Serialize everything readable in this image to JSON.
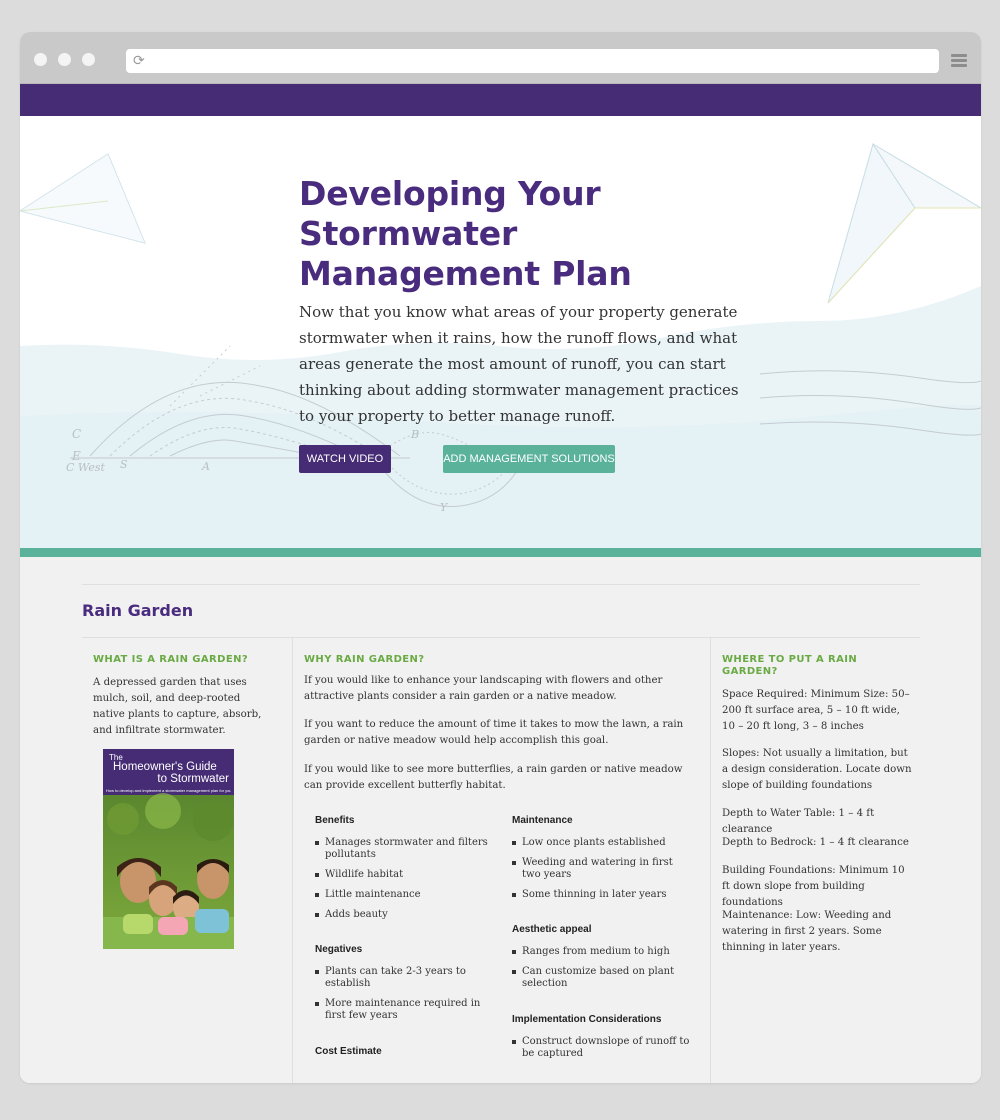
{
  "browser": {
    "reload_glyph": "⟳"
  },
  "hero": {
    "title": "Developing Your Stormwater Management Plan",
    "intro": "Now that you know what areas of your property generate stormwater when it rains, how the runoff flows, and what areas generate the most amount of runoff, you can start thinking about adding stormwater management practices to your property to better manage runoff.",
    "watch_video_label": "WATCH VIDEO",
    "add_solutions_label": "ADD MANAGEMENT SOLUTIONS",
    "sketch_labels": [
      "E",
      "C",
      "C West",
      "S",
      "A",
      "B",
      "Y"
    ]
  },
  "section": {
    "title": "Rain Garden"
  },
  "col1": {
    "heading": "WHAT IS A RAIN GARDEN?",
    "text": "A depressed garden that uses mulch, soil, and deep-rooted native plants to capture, absorb, and infiltrate stormwater.",
    "booklet": {
      "title_line1": "The",
      "title_line2": "Homeowner's Guide",
      "title_line3": "to Stormwater",
      "subtitle": "How to develop and implement a stormwater management plan for your property"
    }
  },
  "col2": {
    "heading": "WHY RAIN GARDEN?",
    "paragraphs": [
      "If you would like to enhance your landscaping with flowers and other attractive plants consider a rain garden or a native meadow.",
      "If you want to reduce the amount of time it takes to mow the lawn, a rain garden or native meadow would help accomplish this goal.",
      "If you would like to see more butterflies, a rain garden or native meadow can provide excellent butterfly habitat."
    ],
    "benefits": {
      "title": "Benefits",
      "items": [
        "Manages stormwater and filters pollutants",
        "Wildlife habitat",
        "Little maintenance",
        "Adds beauty"
      ]
    },
    "negatives": {
      "title": "Negatives",
      "items": [
        "Plants can take 2-3 years to establish",
        "More maintenance required in first few years"
      ]
    },
    "cost": {
      "title": "Cost Estimate"
    },
    "maintenance": {
      "title": "Maintenance",
      "items": [
        "Low once plants established",
        "Weeding and watering in first two years",
        "Some thinning in later years"
      ]
    },
    "aesthetic": {
      "title": "Aesthetic appeal",
      "items": [
        "Ranges from medium to high",
        "Can customize based on plant selection"
      ]
    },
    "implementation": {
      "title": "Implementation Considerations",
      "items": [
        "Construct downslope of runoff to be captured"
      ]
    }
  },
  "col3": {
    "heading": "WHERE TO PUT A RAIN GARDEN?",
    "items": [
      "Space Required: Minimum Size: 50–200 ft surface area, 5 – 10 ft wide, 10 – 20 ft long, 3 – 8 inches",
      "Slopes: Not usually a limitation, but a design consideration. Locate down slope of building foundations",
      "Depth to Water Table: 1 – 4 ft clearance",
      "Depth to Bedrock: 1 – 4 ft clearance",
      "Building Foundations: Minimum 10 ft down slope from building foundations",
      "Maintenance: Low: Weeding and watering in first 2 years. Some thinning in later years."
    ]
  },
  "colors": {
    "purple": "#462c74",
    "teal": "#5ab29b",
    "green_heading": "#6aaa44"
  }
}
